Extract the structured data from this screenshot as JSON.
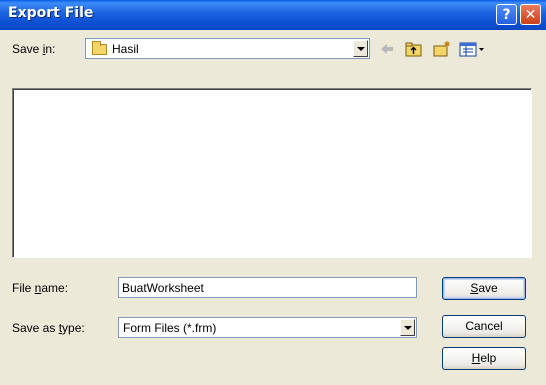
{
  "window": {
    "title": "Export File",
    "help_button": "?",
    "close_button": "✕"
  },
  "save_in": {
    "label_pre": "Save ",
    "label_accel": "i",
    "label_post": "n:",
    "value": "Hasil"
  },
  "toolbar": {
    "icons": [
      "back-arrow-icon",
      "up-folder-icon",
      "new-folder-icon",
      "view-menu-icon"
    ]
  },
  "file_name": {
    "label_pre": "File ",
    "label_accel": "n",
    "label_post": "ame:",
    "value": "BuatWorksheet"
  },
  "save_as_type": {
    "label_pre": "Save as ",
    "label_accel": "t",
    "label_post": "ype:",
    "value": "Form Files (*.frm)"
  },
  "buttons": {
    "save_accel": "S",
    "save_rest": "ave",
    "cancel": "Cancel",
    "help_accel": "H",
    "help_rest": "elp"
  }
}
